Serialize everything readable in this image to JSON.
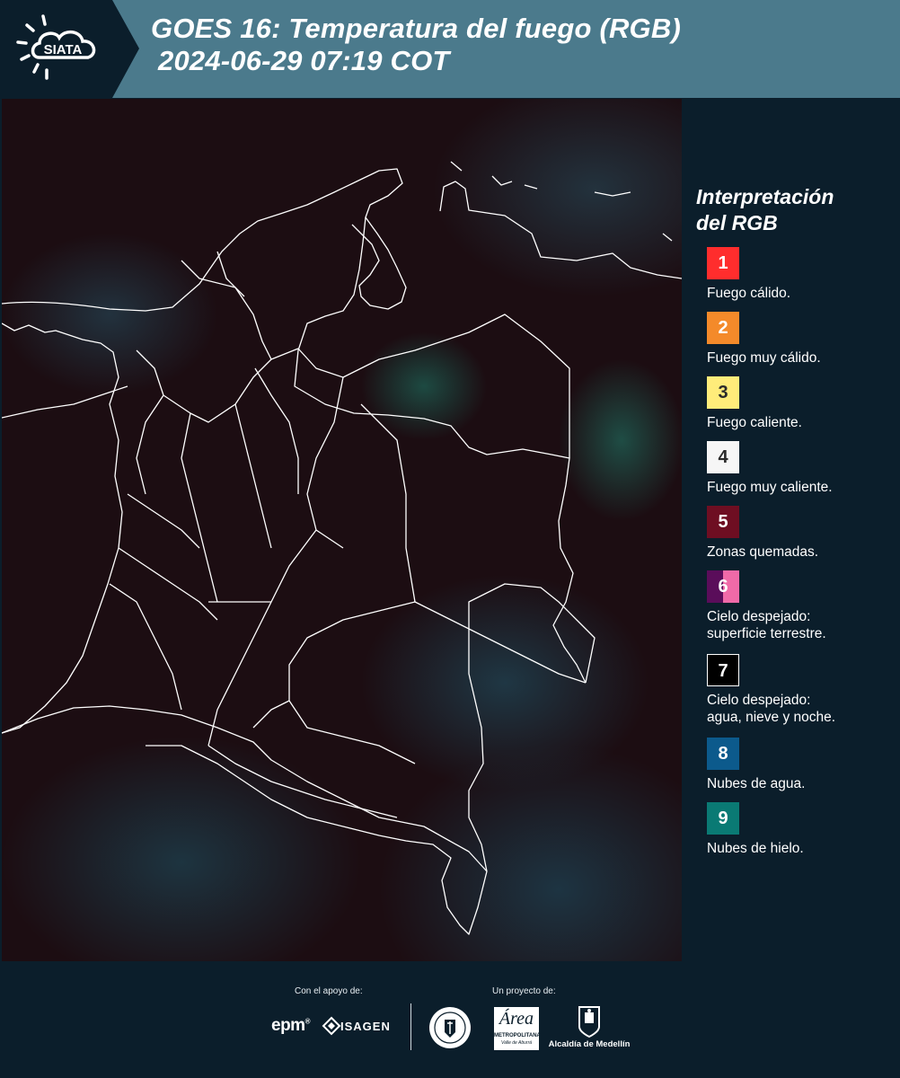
{
  "header": {
    "brand": "SIATA",
    "title_line1": "GOES 16: Temperatura del fuego (RGB)",
    "title_line2": "2024-06-29 07:19 COT"
  },
  "legend": {
    "title_line1": "Interpretación",
    "title_line2": "del RGB",
    "items": [
      {
        "number": "1",
        "label": "Fuego cálido.",
        "color": "#ff2d2d",
        "text_color": "#ffffff"
      },
      {
        "number": "2",
        "label": "Fuego muy cálido.",
        "color": "#f48a2a",
        "text_color": "#ffffff"
      },
      {
        "number": "3",
        "label": "Fuego caliente.",
        "color": "#ffec7a",
        "text_color": "#2a2a2a"
      },
      {
        "number": "4",
        "label": "Fuego muy caliente.",
        "color": "#f6f6f6",
        "text_color": "#2a2a2a"
      },
      {
        "number": "5",
        "label": "Zonas quemadas.",
        "color": "#6e0e22",
        "text_color": "#ffffff"
      },
      {
        "number": "6",
        "label": "Cielo despejado:",
        "label2": "superficie terrestre.",
        "color": "#5a0d5a",
        "color2": "#f06aa8",
        "text_color": "#ffffff"
      },
      {
        "number": "7",
        "label": "Cielo despejado:",
        "label2": "agua, nieve y noche.",
        "color": "#000000",
        "text_color": "#ffffff"
      },
      {
        "number": "8",
        "label": "Nubes de agua.",
        "color": "#0c5a8c",
        "text_color": "#ffffff"
      },
      {
        "number": "9",
        "label": "Nubes de hielo.",
        "color": "#0a7a74",
        "text_color": "#ffffff"
      }
    ]
  },
  "footer": {
    "support_label": "Con el apoyo de:",
    "project_label": "Un proyecto de:",
    "epm": "epm",
    "isagen": "ISAGEN",
    "area_name": "Área",
    "area_sub1": "METROPOLITANA",
    "area_sub2": "Valle de Aburrá",
    "alcaldia": "Alcaldía de Medellín"
  }
}
